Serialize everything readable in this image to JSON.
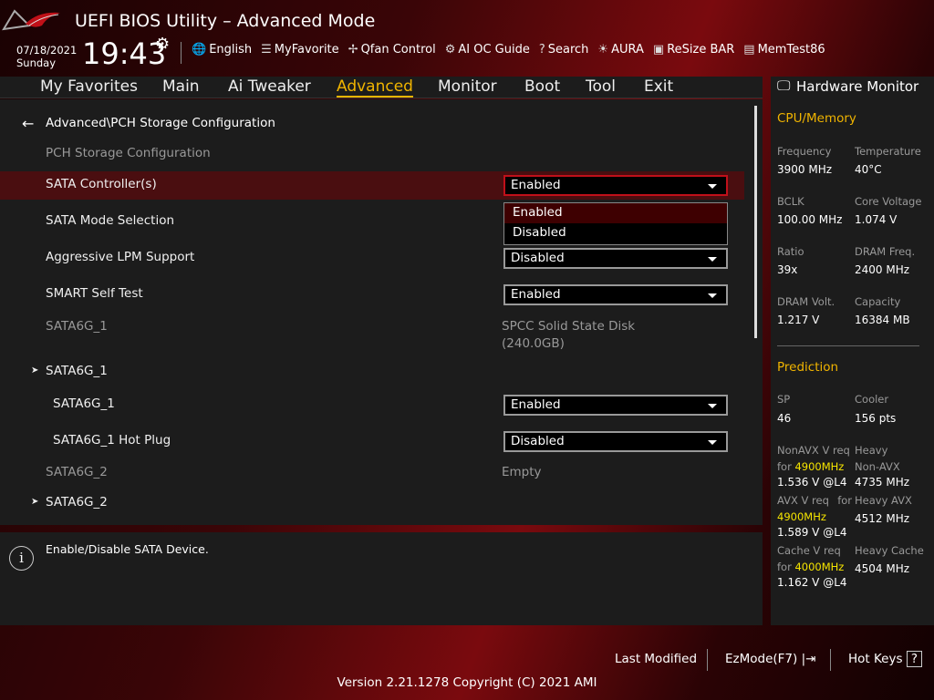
{
  "header": {
    "title": "UEFI BIOS Utility – Advanced Mode",
    "date": "07/18/2021",
    "day": "Sunday",
    "time": "19:43",
    "tools": [
      {
        "icon": "globe-icon",
        "glyph": "🌐",
        "label": "English"
      },
      {
        "icon": "favorite-icon",
        "glyph": "☰",
        "label": "MyFavorite"
      },
      {
        "icon": "fan-icon",
        "glyph": "✢",
        "label": "Qfan Control"
      },
      {
        "icon": "ai-chip-icon",
        "glyph": "⚙",
        "label": "AI OC Guide"
      },
      {
        "icon": "search-icon",
        "glyph": "?",
        "label": "Search"
      },
      {
        "icon": "aura-icon",
        "glyph": "☀",
        "label": "AURA"
      },
      {
        "icon": "resize-bar-icon",
        "glyph": "▣",
        "label": "ReSize BAR"
      },
      {
        "icon": "memtest-icon",
        "glyph": "▤",
        "label": "MemTest86"
      }
    ]
  },
  "tabs": [
    "My Favorites",
    "Main",
    "Ai Tweaker",
    "Advanced",
    "Monitor",
    "Boot",
    "Tool",
    "Exit"
  ],
  "active_tab": "Advanced",
  "breadcrumb": "Advanced\\PCH Storage Configuration",
  "section": "PCH Storage Configuration",
  "items": {
    "sata_controller": {
      "label": "SATA Controller(s)",
      "value": "Enabled"
    },
    "sata_mode": {
      "label": "SATA Mode Selection"
    },
    "lpm": {
      "label": "Aggressive LPM Support",
      "value": "Disabled"
    },
    "smart": {
      "label": "SMART Self Test",
      "value": "Enabled"
    },
    "sata1_info": {
      "label": "SATA6G_1",
      "value1": "SPCC Solid State Disk",
      "value2": "(240.0GB)"
    },
    "sata1_sub": {
      "label": "SATA6G_1"
    },
    "sata1_enable": {
      "label": "SATA6G_1",
      "value": "Enabled"
    },
    "sata1_hotplug": {
      "label": "SATA6G_1 Hot Plug",
      "value": "Disabled"
    },
    "sata2_info": {
      "label": "SATA6G_2",
      "value": "Empty"
    },
    "sata2_sub": {
      "label": "SATA6G_2"
    }
  },
  "dropdown": {
    "options": [
      "Enabled",
      "Disabled"
    ],
    "selected": "Enabled"
  },
  "help": "Enable/Disable SATA Device.",
  "hw": {
    "title": "Hardware Monitor",
    "cpu_title": "CPU/Memory",
    "cpu": [
      {
        "label": "Frequency",
        "value": "3900 MHz"
      },
      {
        "label": "Temperature",
        "value": "40°C"
      },
      {
        "label": "BCLK",
        "value": "100.00 MHz"
      },
      {
        "label": "Core Voltage",
        "value": "1.074 V"
      },
      {
        "label": "Ratio",
        "value": "39x"
      },
      {
        "label": "DRAM Freq.",
        "value": "2400 MHz"
      },
      {
        "label": "DRAM Volt.",
        "value": "1.217 V"
      },
      {
        "label": "Capacity",
        "value": "16384 MB"
      }
    ],
    "pred_title": "Prediction",
    "sp_label": "SP",
    "sp": "46",
    "cooler_label": "Cooler",
    "cooler": "156 pts",
    "nonavx_l1": "NonAVX V req",
    "nonavx_for": "for ",
    "nonavx_freq": "4900MHz",
    "nonavx_v": "1.536 V @L4",
    "heavy_nonavx_1": "Heavy",
    "heavy_nonavx_2": "Non-AVX",
    "heavy_nonavx_v": "4735 MHz",
    "avx_l1": "AVX V req",
    "avx_for": "for",
    "avx_freq": "4900MHz",
    "avx_v": "1.589 V @L4",
    "heavy_avx": "Heavy AVX",
    "heavy_avx_v": "4512 MHz",
    "cache_l1": "Cache V req",
    "cache_for": "for ",
    "cache_freq": "4000MHz",
    "cache_v": "1.162 V @L4",
    "heavy_cache": "Heavy Cache",
    "heavy_cache_v": "4504 MHz"
  },
  "footer": {
    "last_modified": "Last Modified",
    "ezmode": "EzMode(F7)",
    "hotkeys": "Hot Keys",
    "hotkeys_glyph": "?",
    "version": "Version 2.21.1278 Copyright (C) 2021 AMI"
  }
}
